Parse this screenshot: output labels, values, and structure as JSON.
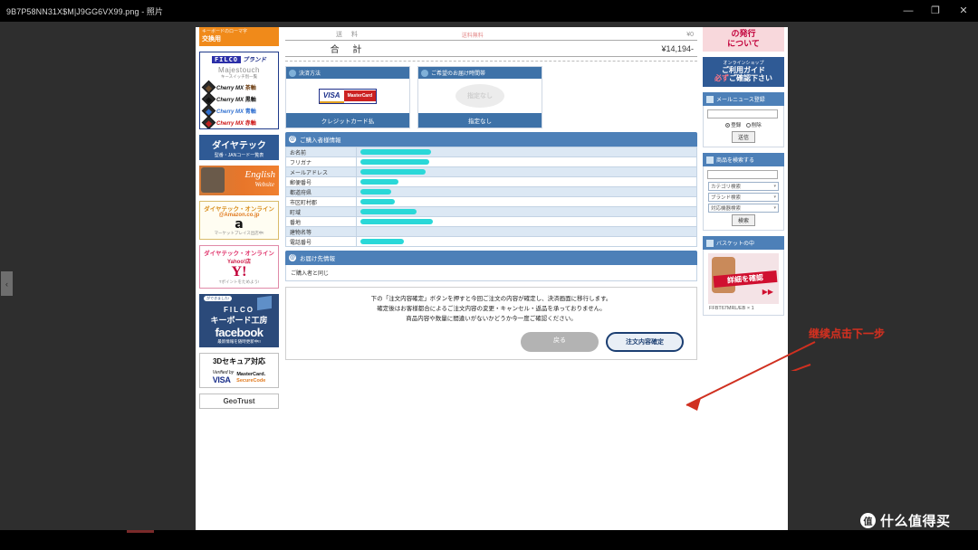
{
  "window": {
    "title": "9B7P58NN31X$M|J9GG6VX99.png - 照片",
    "minimize_label": "—",
    "maximize_label": "❐",
    "close_label": "✕",
    "nav_prev_label": "‹"
  },
  "watermark": {
    "logo": "值",
    "text": "什么值得买"
  },
  "annotation": {
    "text": "继续点击下一步"
  },
  "page": {
    "left_sidebar": {
      "orange_banner": {
        "line1": "キーボードのローマ字",
        "line2": "交換用"
      },
      "filco": {
        "logo": "FILCO",
        "brand_label": "ブランド",
        "title": "Majestouch",
        "subtitle": "キースイッチ別一覧",
        "switches": [
          {
            "name": "Cherry MX",
            "axis": "茶軸",
            "color": "#6b3b10"
          },
          {
            "name": "Cherry MX",
            "axis": "黒軸",
            "color": "#111111"
          },
          {
            "name": "Cherry MX",
            "axis": "青軸",
            "color": "#2f6fd0"
          },
          {
            "name": "Cherry MX",
            "axis": "赤軸",
            "color": "#cc1111"
          }
        ]
      },
      "diatec": {
        "main": "ダイヤテック",
        "sub": "型番・JANコード一覧表"
      },
      "english": {
        "line1": "English",
        "line2": "Website"
      },
      "amazon": {
        "line1": "ダイヤテック・オンライン",
        "line2": "@Amazon.co.jp",
        "logo": "a",
        "note": "マーケットプレイス出店中!"
      },
      "yahoo": {
        "line1": "ダイヤテック・オンライン",
        "line2": "Yahoo!店",
        "logo": "Y!",
        "note": "Tポイントをためよう!"
      },
      "facebook": {
        "bubble": "ができました!",
        "line1": "FILCO",
        "line2": "キーボード工房",
        "line3": "facebook",
        "line4": "最新情報を随時更新中!!"
      },
      "secure3d": {
        "title": "3Dセキュア対応",
        "visa_top": "Verified by",
        "visa": "VISA",
        "mc_top": "MasterCard.",
        "mc_bottom": "SecureCode"
      },
      "trust": {
        "title": "GeoTrust"
      }
    },
    "totals": {
      "rows": [
        {
          "label": "送 料",
          "note": "送料無料",
          "value": "¥0"
        },
        {
          "label": "合 計",
          "note": "",
          "value": "¥14,194-"
        }
      ]
    },
    "payment_card": {
      "header": "決済方法",
      "visa": "VISA",
      "mastercard": "MasterCard",
      "button": "クレジットカード払"
    },
    "delivery_card": {
      "header": "ご希望のお届け時間帯",
      "badge": "指定なし",
      "button": "指定なし"
    },
    "buyer_section": {
      "header": "ご購入者様情報",
      "icon": "@",
      "rows": [
        {
          "key": "お名前",
          "value": "",
          "redacted": true,
          "redact_width": 78
        },
        {
          "key": "フリガナ",
          "value": "",
          "redacted": true,
          "redact_width": 76
        },
        {
          "key": "メールアドレス",
          "value": "",
          "redacted": true,
          "redact_width": 72
        },
        {
          "key": "郵便番号",
          "value": "",
          "redacted": true,
          "redact_width": 42
        },
        {
          "key": "都道府県",
          "value": "",
          "redacted": true,
          "redact_width": 34
        },
        {
          "key": "市区町村郡",
          "value": "",
          "redacted": true,
          "redact_width": 38
        },
        {
          "key": "町域",
          "value": "",
          "redacted": true,
          "redact_width": 62
        },
        {
          "key": "番地",
          "value": "",
          "redacted": true,
          "redact_width": 80
        },
        {
          "key": "建物名等",
          "value": "",
          "redacted": false,
          "redact_width": 0
        },
        {
          "key": "電話番号",
          "value": "",
          "redacted": true,
          "redact_width": 48
        }
      ]
    },
    "shipping_section": {
      "header": "お届け先情報",
      "icon": "@",
      "body": "ご購入者と同じ"
    },
    "notice": {
      "line1": "下の「注文内容確定」ボタンを押すと今回ご注文の内容が確定し、決済画面に移行します。",
      "line2": "確定後はお客様都合によるご注文内容の変更・キャンセル・返品を承っておりません。",
      "line3": "商品内容や数量に間違いがないかどうか今一度ご確認ください。",
      "back_button": "戻る",
      "confirm_button": "注文内容確定"
    },
    "right_sidebar": {
      "pink_banner": {
        "line1": "の発行",
        "line2": "について"
      },
      "guide": {
        "line0": "オンラインショップ",
        "line1": "ご利用ガイド",
        "line2_em": "必ず",
        "line2": "ご確認下さい"
      },
      "mailnews": {
        "header": "メールニュース登録",
        "input_value": "",
        "radio_register": "登録",
        "radio_delete": "削除",
        "submit": "送信"
      },
      "search": {
        "header": "商品を検索する",
        "input_value": "",
        "selects": [
          "カテゴリ検索",
          "ブランド検索",
          "対応機器検索"
        ],
        "button": "検索"
      },
      "basket": {
        "header": "バスケットの中",
        "promo": "詳細を確認",
        "item": "FFBT67MRL/EB × 1"
      }
    }
  }
}
